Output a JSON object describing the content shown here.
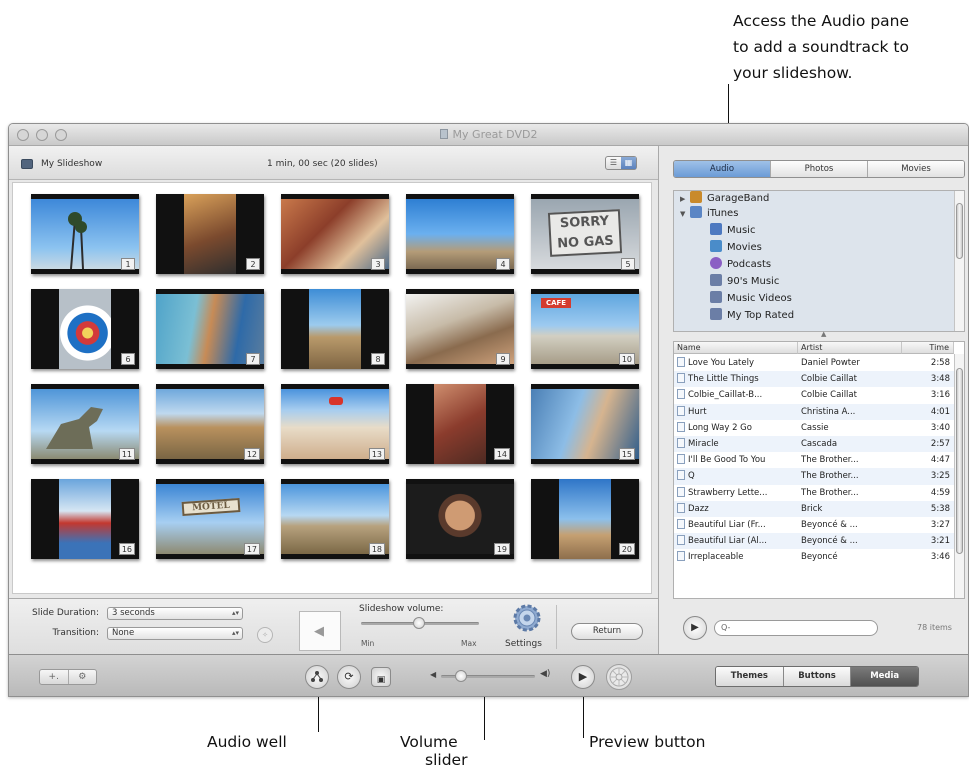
{
  "callouts": {
    "audio_pane": [
      "Access the Audio pane",
      "to add a soundtrack to",
      "your slideshow."
    ],
    "audio_well": "Audio well",
    "volume_slider": [
      "Volume",
      "slider"
    ],
    "preview_button": "Preview button"
  },
  "window": {
    "title": "My Great DVD2"
  },
  "slideshow": {
    "title": "My Slideshow",
    "info": "1 min, 00 sec  (20 slides)",
    "view_toggle": [
      "☰",
      "▦"
    ],
    "slides": [
      {
        "n": "1"
      },
      {
        "n": "2"
      },
      {
        "n": "3"
      },
      {
        "n": "4"
      },
      {
        "n": "5"
      },
      {
        "n": "6"
      },
      {
        "n": "7"
      },
      {
        "n": "8"
      },
      {
        "n": "9"
      },
      {
        "n": "10"
      },
      {
        "n": "11"
      },
      {
        "n": "12"
      },
      {
        "n": "13"
      },
      {
        "n": "14"
      },
      {
        "n": "15"
      },
      {
        "n": "16"
      },
      {
        "n": "17"
      },
      {
        "n": "18"
      },
      {
        "n": "19"
      },
      {
        "n": "20"
      }
    ]
  },
  "settings": {
    "slide_duration_label": "Slide Duration:",
    "slide_duration_value": "3 seconds",
    "transition_label": "Transition:",
    "transition_value": "None",
    "volume_label": "Slideshow volume:",
    "min_label": "Min",
    "max_label": "Max",
    "settings_label": "Settings",
    "return_label": "Return"
  },
  "media_browser": {
    "tabs": [
      "Audio",
      "Photos",
      "Movies"
    ],
    "active_tab": "Audio",
    "sources": [
      {
        "label": "GarageBand",
        "color": "#c98a2b"
      },
      {
        "label": "iTunes",
        "color": "#5b86c5"
      },
      {
        "label": "Music",
        "color": "#4d79c0"
      },
      {
        "label": "Movies",
        "color": "#4a8cc9"
      },
      {
        "label": "Podcasts",
        "color": "#8b5fc4"
      },
      {
        "label": "90's Music",
        "color": "#6b7ea6"
      },
      {
        "label": "Music Videos",
        "color": "#6b7ea6"
      },
      {
        "label": "My Top Rated",
        "color": "#6b7ea6"
      }
    ],
    "columns": [
      "Name",
      "Artist",
      "Time"
    ],
    "songs": [
      {
        "name": "Love You Lately",
        "artist": "Daniel Powter",
        "time": "2:58"
      },
      {
        "name": "The Little Things",
        "artist": "Colbie Caillat",
        "time": "3:48"
      },
      {
        "name": "Colbie_Caillat-B...",
        "artist": "Colbie Caillat",
        "time": "3:16"
      },
      {
        "name": "Hurt",
        "artist": "Christina A...",
        "time": "4:01"
      },
      {
        "name": "Long Way 2 Go",
        "artist": "Cassie",
        "time": "3:40"
      },
      {
        "name": "Miracle",
        "artist": "Cascada",
        "time": "2:57"
      },
      {
        "name": "I'll Be Good To You",
        "artist": "The Brother...",
        "time": "4:47"
      },
      {
        "name": "Q",
        "artist": "The Brother...",
        "time": "3:25"
      },
      {
        "name": "Strawberry Lette...",
        "artist": "The Brother...",
        "time": "4:59"
      },
      {
        "name": "Dazz",
        "artist": "Brick",
        "time": "5:38"
      },
      {
        "name": "Beautiful Liar (Fr...",
        "artist": "Beyoncé & ...",
        "time": "3:27"
      },
      {
        "name": "Beautiful Liar (Al...",
        "artist": "Beyoncé & ...",
        "time": "3:21"
      },
      {
        "name": "Irreplaceable",
        "artist": "Beyoncé",
        "time": "3:46"
      }
    ],
    "search_placeholder": "Q-",
    "item_count": "78 items"
  },
  "bottom_bar": {
    "add_remove": [
      "+.",
      "⚙"
    ],
    "modes": [
      "Themes",
      "Buttons",
      "Media"
    ],
    "active_mode": "Media"
  }
}
